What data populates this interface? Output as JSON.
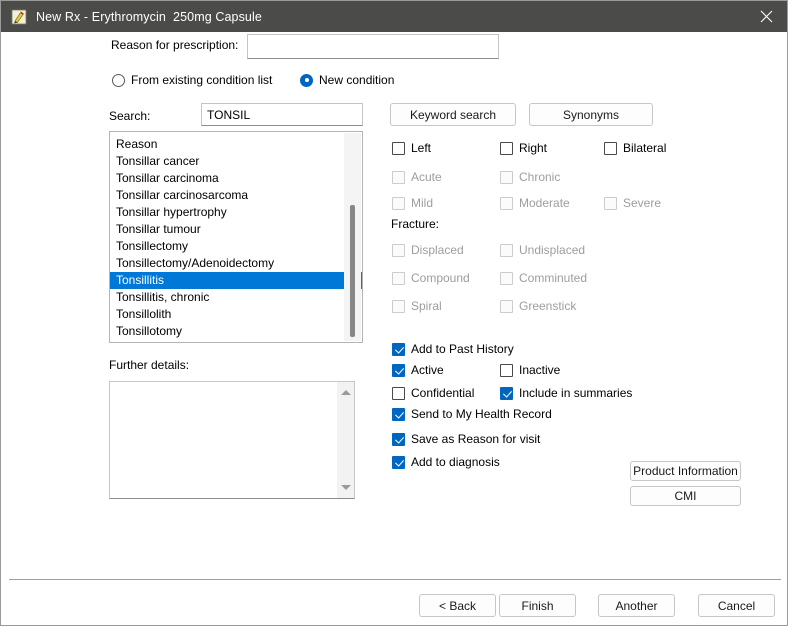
{
  "window": {
    "title": "New Rx - Erythromycin  250mg Capsule",
    "icon": "prescription-pad-icon",
    "close_icon": "close-icon",
    "titlebar_color": "#4b4b49"
  },
  "colors": {
    "accent": "#0067c0",
    "selection": "#0078d7",
    "disabled_text": "#9d9d9d"
  },
  "form": {
    "reason_label": "Reason for prescription:",
    "reason_value": "",
    "reason_placeholder": ""
  },
  "source": {
    "options": [
      {
        "label": "From existing condition list",
        "selected": false
      },
      {
        "label": "New condition",
        "selected": true
      }
    ]
  },
  "search": {
    "label": "Search:",
    "value": "TONSIL",
    "placeholder": "",
    "keyword_button": "Keyword search",
    "synonyms_button": "Synonyms"
  },
  "condition_list": {
    "items": [
      {
        "label": "Reason",
        "selected": false
      },
      {
        "label": "Tonsillar cancer",
        "selected": false
      },
      {
        "label": "Tonsillar carcinoma",
        "selected": false
      },
      {
        "label": "Tonsillar carcinosarcoma",
        "selected": false
      },
      {
        "label": "Tonsillar hypertrophy",
        "selected": false
      },
      {
        "label": "Tonsillar tumour",
        "selected": false
      },
      {
        "label": "Tonsillectomy",
        "selected": false
      },
      {
        "label": "Tonsillectomy/Adenoidectomy",
        "selected": false
      },
      {
        "label": "Tonsillitis",
        "selected": true
      },
      {
        "label": "Tonsillitis, chronic",
        "selected": false
      },
      {
        "label": "Tonsillolith",
        "selected": false
      },
      {
        "label": "Tonsillotomy",
        "selected": false
      }
    ]
  },
  "further_details": {
    "label": "Further details:",
    "value": "",
    "placeholder": ""
  },
  "laterality": [
    {
      "label": "Left",
      "checked": false,
      "disabled": false
    },
    {
      "label": "Right",
      "checked": false,
      "disabled": false
    },
    {
      "label": "Bilateral",
      "checked": false,
      "disabled": false
    }
  ],
  "acuity": [
    {
      "label": "Acute",
      "checked": false,
      "disabled": true
    },
    {
      "label": "Chronic",
      "checked": false,
      "disabled": true
    }
  ],
  "severity": [
    {
      "label": "Mild",
      "checked": false,
      "disabled": true
    },
    {
      "label": "Moderate",
      "checked": false,
      "disabled": true
    },
    {
      "label": "Severe",
      "checked": false,
      "disabled": true
    }
  ],
  "fracture": {
    "label": "Fracture:",
    "rows": [
      [
        {
          "label": "Displaced",
          "checked": false,
          "disabled": true
        },
        {
          "label": "Undisplaced",
          "checked": false,
          "disabled": true
        }
      ],
      [
        {
          "label": "Compound",
          "checked": false,
          "disabled": true
        },
        {
          "label": "Comminuted",
          "checked": false,
          "disabled": true
        }
      ],
      [
        {
          "label": "Spiral",
          "checked": false,
          "disabled": true
        },
        {
          "label": "Greenstick",
          "checked": false,
          "disabled": true
        }
      ]
    ]
  },
  "options": {
    "add_to_past_history": {
      "label": "Add to Past History",
      "checked": true,
      "disabled": false
    },
    "active": {
      "label": "Active",
      "checked": true,
      "disabled": false
    },
    "inactive": {
      "label": "Inactive",
      "checked": false,
      "disabled": false
    },
    "confidential": {
      "label": "Confidential",
      "checked": false,
      "disabled": false
    },
    "include_in_summaries": {
      "label": "Include in summaries",
      "checked": true,
      "disabled": false
    },
    "send_to_my_health_record": {
      "label": "Send to My Health Record",
      "checked": true,
      "disabled": false
    },
    "save_as_reason_for_visit": {
      "label": "Save as Reason for visit",
      "checked": true,
      "disabled": false
    },
    "add_to_diagnosis": {
      "label": "Add to diagnosis",
      "checked": true,
      "disabled": false
    }
  },
  "info_buttons": {
    "product_information": "Product Information",
    "cmi": "CMI"
  },
  "footer": {
    "back": "< Back",
    "finish": "Finish",
    "another": "Another",
    "cancel": "Cancel"
  }
}
